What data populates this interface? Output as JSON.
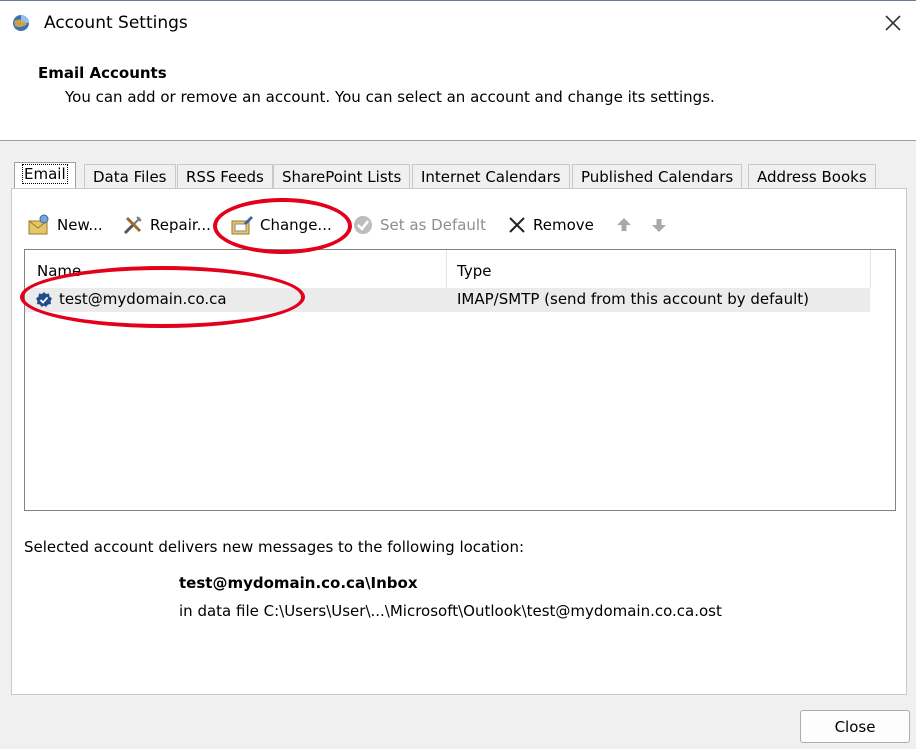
{
  "window": {
    "title": "Account Settings",
    "icon": "outlook-app-icon",
    "close_icon": "close-icon"
  },
  "header": {
    "title": "Email Accounts",
    "subtitle": "You can add or remove an account. You can select an account and change its settings."
  },
  "tabs": [
    {
      "label": "Email",
      "active": true
    },
    {
      "label": "Data Files",
      "active": false
    },
    {
      "label": "RSS Feeds",
      "active": false
    },
    {
      "label": "SharePoint Lists",
      "active": false
    },
    {
      "label": "Internet Calendars",
      "active": false
    },
    {
      "label": "Published Calendars",
      "active": false
    },
    {
      "label": "Address Books",
      "active": false
    }
  ],
  "toolbar": {
    "new": "New...",
    "repair": "Repair...",
    "change": "Change...",
    "set_default": "Set as Default",
    "remove": "Remove"
  },
  "list": {
    "columns": [
      "Name",
      "Type"
    ],
    "rows": [
      {
        "name": "test@mydomain.co.ca",
        "type": "IMAP/SMTP (send from this account by default)",
        "default_icon": "default-check-icon"
      }
    ]
  },
  "location": {
    "caption": "Selected account delivers new messages to the following location:",
    "path": "test@mydomain.co.ca\\Inbox",
    "file": "in data file C:\\Users\\User\\...\\Microsoft\\Outlook\\test@mydomain.co.ca.ost"
  },
  "footer": {
    "close": "Close"
  },
  "colors": {
    "annotation": "#e3001b",
    "selected_row": "#ebebeb",
    "accent_blue": "#1f4e8c"
  }
}
